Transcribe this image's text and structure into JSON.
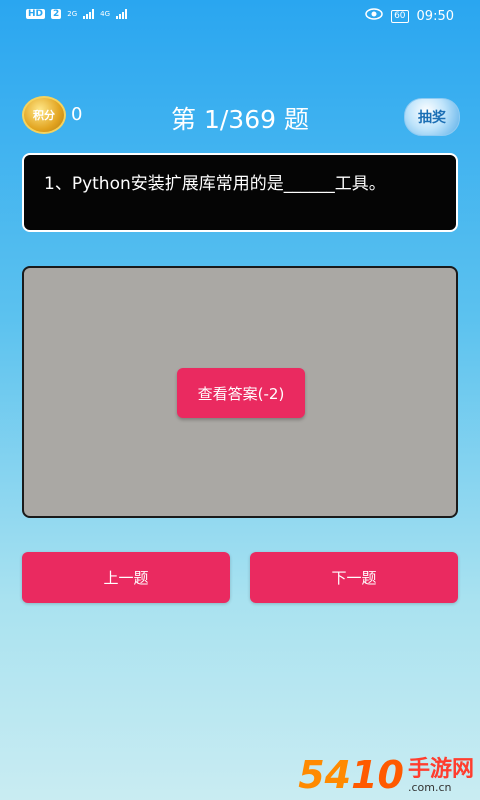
{
  "status_bar": {
    "hd": "HD",
    "sim": "2",
    "net1": "2G",
    "net2": "4G",
    "battery": "60",
    "time": "09:50"
  },
  "header": {
    "coin_label": "积分",
    "score": "0",
    "title": "第 1/369 题",
    "lottery_label": "抽奖"
  },
  "question": {
    "text": "1、Python安装扩展库常用的是______工具。"
  },
  "answer_panel": {
    "show_answer_label": "查看答案(-2)"
  },
  "navigation": {
    "prev_label": "上一题",
    "next_label": "下一题"
  },
  "watermark": {
    "number": "54",
    "mark": "10",
    "text": "手游网",
    "domain": ".com.cn"
  }
}
